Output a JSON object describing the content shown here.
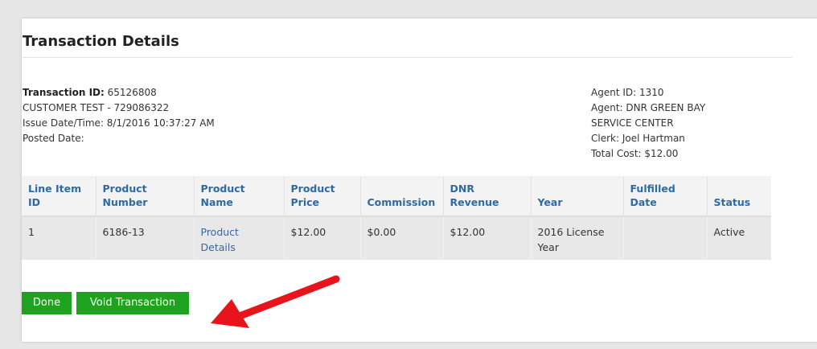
{
  "page": {
    "title": "Transaction Details"
  },
  "transaction": {
    "id_label": "Transaction ID:",
    "id_value": "65126808",
    "customer": "CUSTOMER TEST - 729086322",
    "issue_datetime": "Issue Date/Time: 8/1/2016 10:37:27 AM",
    "posted_date": "Posted Date:"
  },
  "agent": {
    "agent_id": "Agent ID: 1310",
    "agent_line1": "Agent: DNR GREEN BAY",
    "agent_line2": "SERVICE CENTER",
    "clerk": "Clerk: Joel Hartman",
    "total_cost": "Total Cost: $12.00"
  },
  "table": {
    "headers": [
      [
        "Line Item",
        "ID"
      ],
      [
        "Product",
        "Number"
      ],
      [
        "Product",
        "Name"
      ],
      [
        "Product",
        "Price"
      ],
      [
        "Commission",
        ""
      ],
      [
        "DNR",
        "Revenue"
      ],
      [
        "Year",
        ""
      ],
      [
        "Fulfilled",
        "Date"
      ],
      [
        "Status",
        ""
      ]
    ],
    "rows": [
      {
        "line_item_id": "1",
        "product_number": "6186-13",
        "product_name_1": "Product",
        "product_name_2": "Details",
        "product_price": "$12.00",
        "commission": "$0.00",
        "dnr_revenue": "$12.00",
        "year_1": "2016 License",
        "year_2": "Year",
        "fulfilled_date": "",
        "status": "Active"
      }
    ]
  },
  "buttons": {
    "done": "Done",
    "void": "Void Transaction"
  },
  "colors": {
    "button_green": "#1fa31f",
    "header_link_blue": "#2f6aa3",
    "arrow_red": "#e8141b"
  }
}
